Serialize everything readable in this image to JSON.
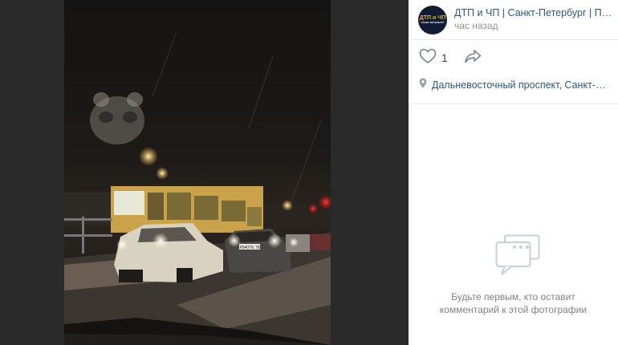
{
  "author": {
    "name": "ДТП и ЧП | Санкт-Петербург | Питер",
    "time": "час назад",
    "avatar_text_line1": "ДТП и ЧП",
    "avatar_text_line2": "САНКТ-ПЕТЕРБУРГ"
  },
  "actions": {
    "like_count": "1"
  },
  "place": {
    "label": "Дальневосточный проспект, Санкт-Петербург"
  },
  "comments": {
    "empty_line1": "Будьте первым, кто оставит",
    "empty_line2": "комментарий к этой фотографии"
  },
  "photo": {
    "plate_text": "Р840ТЕ 78"
  },
  "colors": {
    "link": "#2a5885",
    "muted": "#939393",
    "accent_icon": "#99a2ad"
  },
  "icons": [
    "heart-icon",
    "share-icon",
    "location-pin-icon",
    "comments-empty-icon"
  ]
}
